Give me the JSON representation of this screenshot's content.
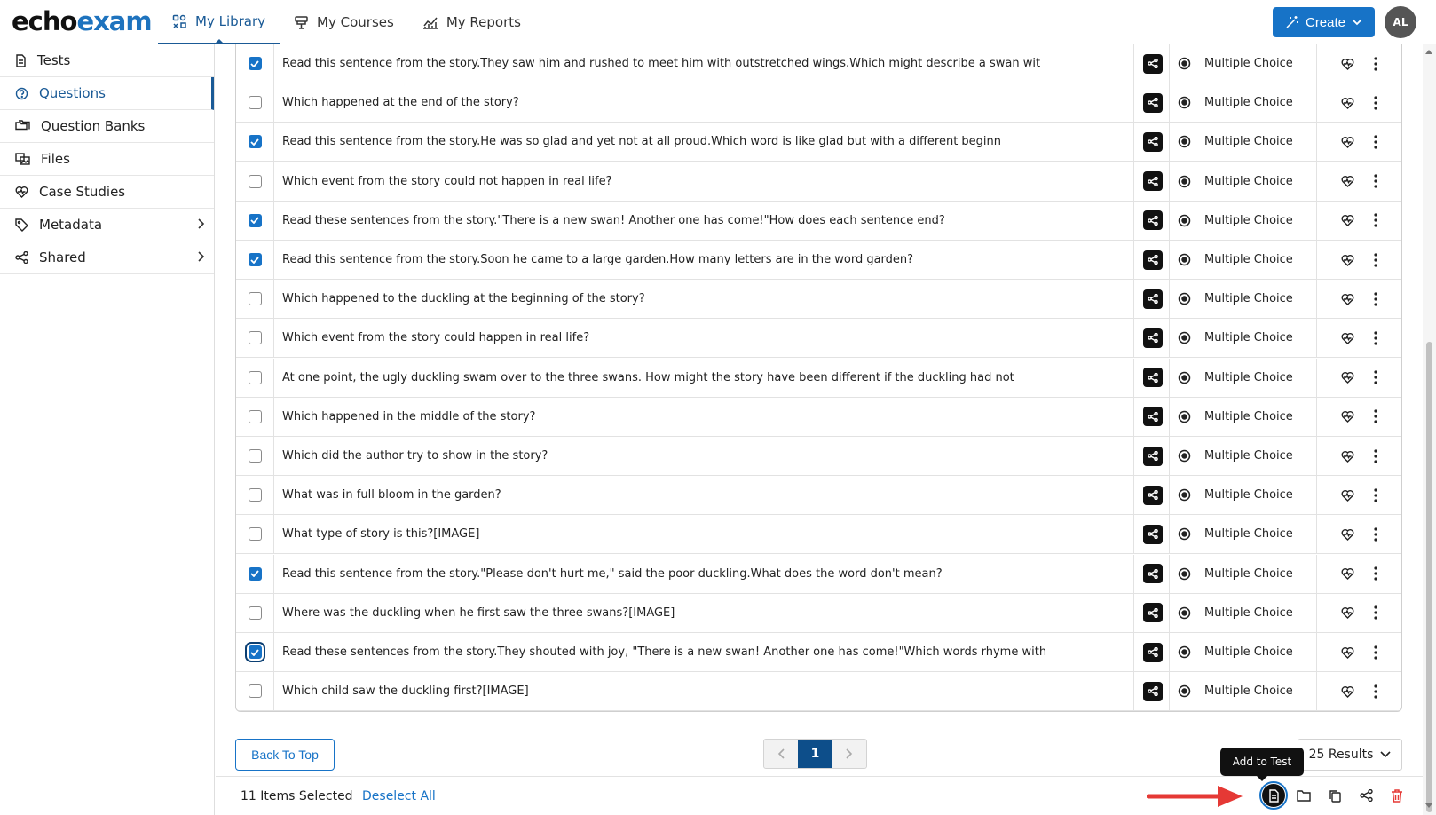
{
  "brand": {
    "part1": "echo",
    "part2": "exam"
  },
  "nav": [
    {
      "label": "My Library",
      "icon": "library-icon",
      "active": true
    },
    {
      "label": "My Courses",
      "icon": "courses-icon",
      "active": false
    },
    {
      "label": "My Reports",
      "icon": "reports-icon",
      "active": false
    }
  ],
  "header": {
    "create_label": "Create",
    "avatar_initials": "AL"
  },
  "sidebar": {
    "items": [
      {
        "label": "Tests",
        "icon": "document-icon"
      },
      {
        "label": "Questions",
        "icon": "question-icon",
        "active": true
      },
      {
        "label": "Question Banks",
        "icon": "folders-icon"
      },
      {
        "label": "Files",
        "icon": "images-icon"
      },
      {
        "label": "Case Studies",
        "icon": "heart-pulse-icon"
      },
      {
        "label": "Metadata",
        "icon": "tag-icon",
        "chevron": true
      },
      {
        "label": "Shared",
        "icon": "share-icon",
        "chevron": true
      }
    ]
  },
  "questions": [
    {
      "text": "Read this sentence from the story.They saw him and rushed to meet him with outstretched wings.Which might describe a swan wit",
      "type": "Multiple Choice",
      "checked": true
    },
    {
      "text": "Which happened at the end of the story?",
      "type": "Multiple Choice",
      "checked": false
    },
    {
      "text": "Read this sentence from the story.He was so glad and yet not at all proud.Which word is like glad but with a different beginn",
      "type": "Multiple Choice",
      "checked": true
    },
    {
      "text": "Which event from the story could not happen in real life?",
      "type": "Multiple Choice",
      "checked": false
    },
    {
      "text": "Read these sentences from the story.\"There is a new swan! Another one has come!\"How does each sentence end?",
      "type": "Multiple Choice",
      "checked": true
    },
    {
      "text": "Read this sentence from the story.Soon he came to a large garden.How many letters are in the word garden?",
      "type": "Multiple Choice",
      "checked": true
    },
    {
      "text": "Which happened to the duckling at the beginning of the story?",
      "type": "Multiple Choice",
      "checked": false
    },
    {
      "text": "Which event from the story could happen in real life?",
      "type": "Multiple Choice",
      "checked": false
    },
    {
      "text": "At one point, the ugly duckling swam over to the three swans. How might the story have been different if the duckling had not",
      "type": "Multiple Choice",
      "checked": false
    },
    {
      "text": "Which happened in the middle of the story?",
      "type": "Multiple Choice",
      "checked": false
    },
    {
      "text": "Which did the author try to show in the story?",
      "type": "Multiple Choice",
      "checked": false
    },
    {
      "text": "What was in full bloom in the garden?",
      "type": "Multiple Choice",
      "checked": false
    },
    {
      "text": "What type of story is this?[IMAGE]",
      "type": "Multiple Choice",
      "checked": false
    },
    {
      "text": "Read this sentence from the story.\"Please don't hurt me,\" said the poor duckling.What does the word don't mean?",
      "type": "Multiple Choice",
      "checked": true
    },
    {
      "text": "Where was the duckling when he first saw the three swans?[IMAGE]",
      "type": "Multiple Choice",
      "checked": false
    },
    {
      "text": "Read these sentences from the story.They shouted with joy, \"There is a new swan! Another one has come!\"Which words rhyme with",
      "type": "Multiple Choice",
      "checked": true,
      "focused": true
    },
    {
      "text": "Which child saw the duckling first?[IMAGE]",
      "type": "Multiple Choice",
      "checked": false
    }
  ],
  "footer": {
    "back_to_top": "Back To Top",
    "current_page": "1",
    "results_label": "25 Results",
    "selected_count": "11 Items Selected",
    "deselect_all": "Deselect All",
    "tooltip": "Add to Test"
  },
  "colors": {
    "accent": "#1773c7",
    "active_nav": "#1a5a96",
    "annotation_arrow": "#e53935"
  }
}
